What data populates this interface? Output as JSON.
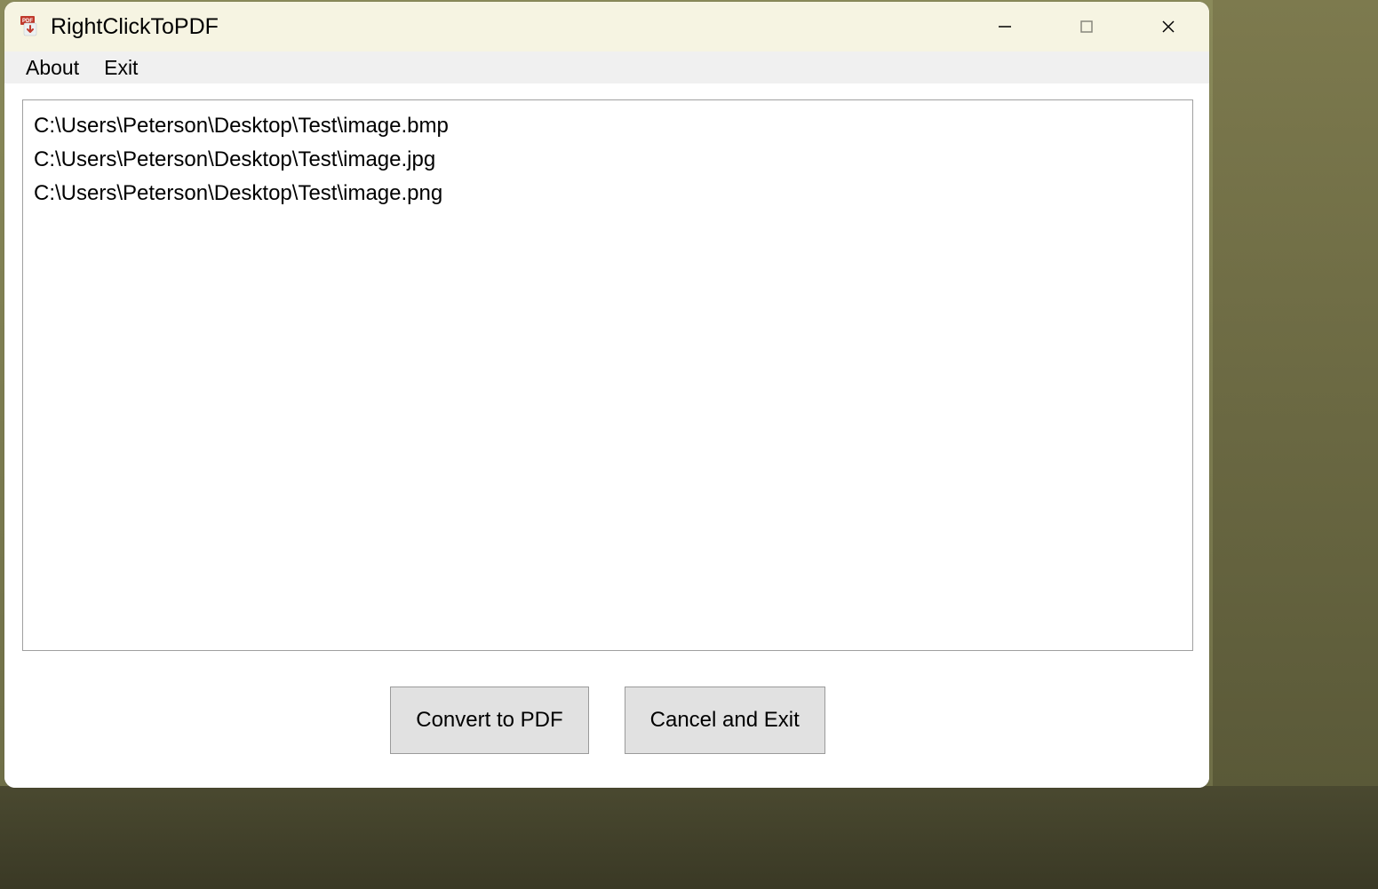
{
  "window": {
    "title": "RightClickToPDF",
    "icon_name": "pdf-app-icon"
  },
  "menubar": {
    "items": [
      {
        "label": "About"
      },
      {
        "label": "Exit"
      }
    ]
  },
  "file_list": {
    "items": [
      "C:\\Users\\Peterson\\Desktop\\Test\\image.bmp",
      "C:\\Users\\Peterson\\Desktop\\Test\\image.jpg",
      "C:\\Users\\Peterson\\Desktop\\Test\\image.png"
    ]
  },
  "buttons": {
    "convert_label": "Convert to PDF",
    "cancel_label": "Cancel and Exit"
  }
}
